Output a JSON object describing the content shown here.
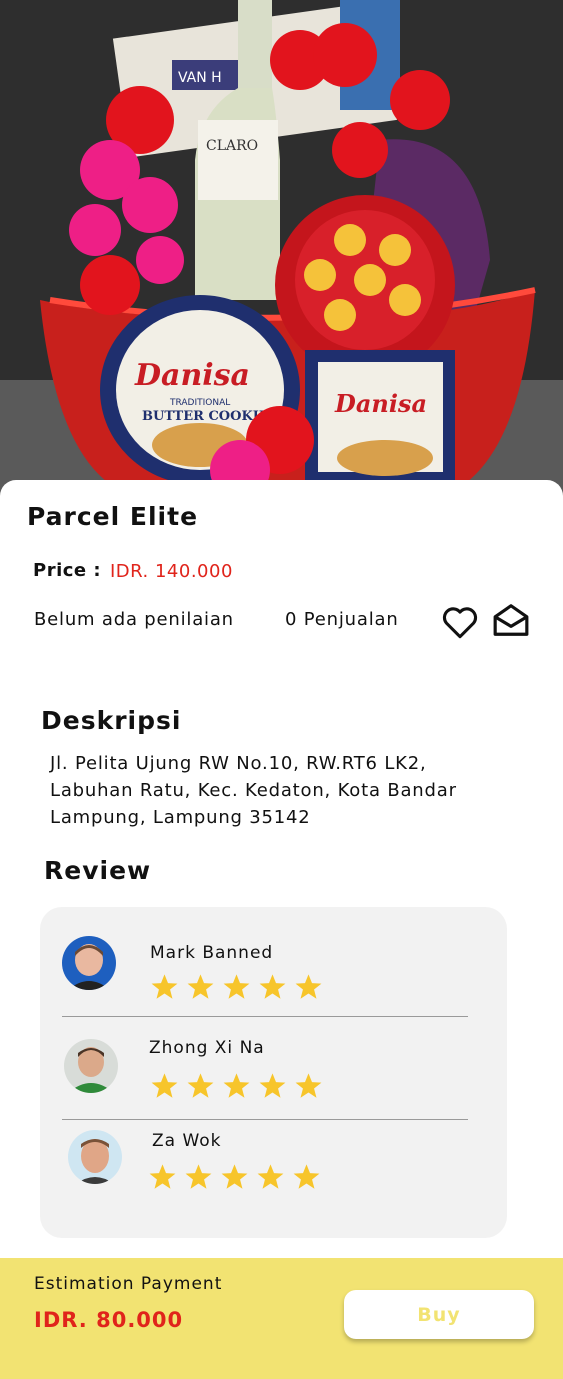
{
  "product": {
    "title": "Parcel Elite",
    "price_label": "Price :",
    "price_value": "IDR. 140.000",
    "rating_text": "Belum ada penilaian",
    "sales_text": "0 Penjualan",
    "image_text": {
      "wine_brand": "CLARO",
      "box_brand": "VAN H",
      "tin_brand": "Danisa",
      "tin_line1": "TRADITIONAL",
      "tin_line2": "BUTTER COOKIES"
    }
  },
  "description": {
    "heading": "Deskripsi",
    "lines": [
      "Jl. Pelita Ujung RW No.10, RW.RT6 LK2,",
      "Labuhan Ratu, Kec. Kedaton, Kota Bandar",
      "Lampung, Lampung 35142"
    ]
  },
  "reviews": {
    "heading": "Review",
    "items": [
      {
        "name": "Mark Banned",
        "stars": 5
      },
      {
        "name": "Zhong Xi Na",
        "stars": 5
      },
      {
        "name": "Za Wok",
        "stars": 5
      }
    ]
  },
  "footer": {
    "estimation_label": "Estimation Payment",
    "total": "IDR. 80.000",
    "buy_label": "Buy"
  },
  "colors": {
    "accent_red": "#e0241b",
    "footer_yellow": "#f2e372",
    "star": "#f7c52b",
    "card_bg": "#f2f2f2"
  },
  "icons": [
    "heart-icon",
    "mail-icon",
    "star-icon"
  ]
}
